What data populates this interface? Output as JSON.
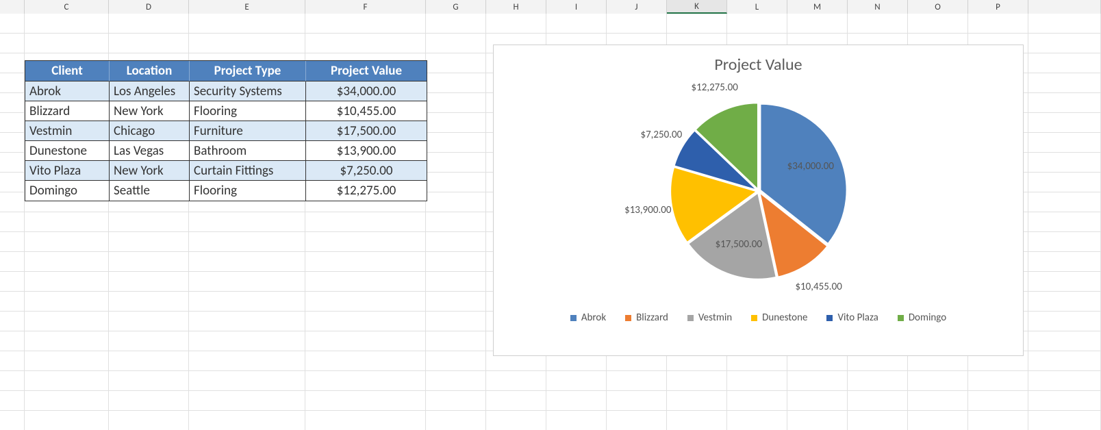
{
  "columns": {
    "stub_width": 36,
    "letters": [
      "C",
      "D",
      "E",
      "F",
      "G",
      "H",
      "I",
      "J",
      "K",
      "L",
      "M",
      "N",
      "O",
      "P"
    ],
    "widths": [
      123,
      117,
      170,
      176,
      88,
      88,
      88,
      88,
      88,
      88,
      88,
      88,
      88,
      88
    ],
    "selected": "K"
  },
  "table": {
    "headers": [
      "Client",
      "Location",
      "Project Type",
      "Project Value"
    ],
    "rows": [
      {
        "client": "Abrok",
        "location": "Los Angeles",
        "type": "Security Systems",
        "value": "$34,000.00",
        "band": true
      },
      {
        "client": "Blizzard",
        "location": "New York",
        "type": "Flooring",
        "value": "$10,455.00",
        "band": false
      },
      {
        "client": "Vestmin",
        "location": "Chicago",
        "type": "Furniture",
        "value": "$17,500.00",
        "band": true
      },
      {
        "client": "Dunestone",
        "location": "Las Vegas",
        "type": "Bathroom",
        "value": "$13,900.00",
        "band": false
      },
      {
        "client": "Vito Plaza",
        "location": "New York",
        "type": "Curtain Fittings",
        "value": "$7,250.00",
        "band": true
      },
      {
        "client": "Domingo",
        "location": "Seattle",
        "type": "Flooring",
        "value": "$12,275.00",
        "band": false
      }
    ]
  },
  "chart_data": {
    "type": "pie",
    "title": "Project Value",
    "series": [
      {
        "name": "Abrok",
        "value": 34000.0,
        "label": "$34,000.00",
        "color": "#4f81bd"
      },
      {
        "name": "Blizzard",
        "value": 10455.0,
        "label": "$10,455.00",
        "color": "#ed7d31"
      },
      {
        "name": "Vestmin",
        "value": 17500.0,
        "label": "$17,500.00",
        "color": "#a5a5a5"
      },
      {
        "name": "Dunestone",
        "value": 13900.0,
        "label": "$13,900.00",
        "color": "#ffc000"
      },
      {
        "name": "Vito Plaza",
        "value": 7250.0,
        "label": "$7,250.00",
        "color": "#2e5fac"
      },
      {
        "name": "Domingo",
        "value": 12275.0,
        "label": "$12,275.00",
        "color": "#70ad47"
      }
    ],
    "legend_position": "bottom"
  }
}
